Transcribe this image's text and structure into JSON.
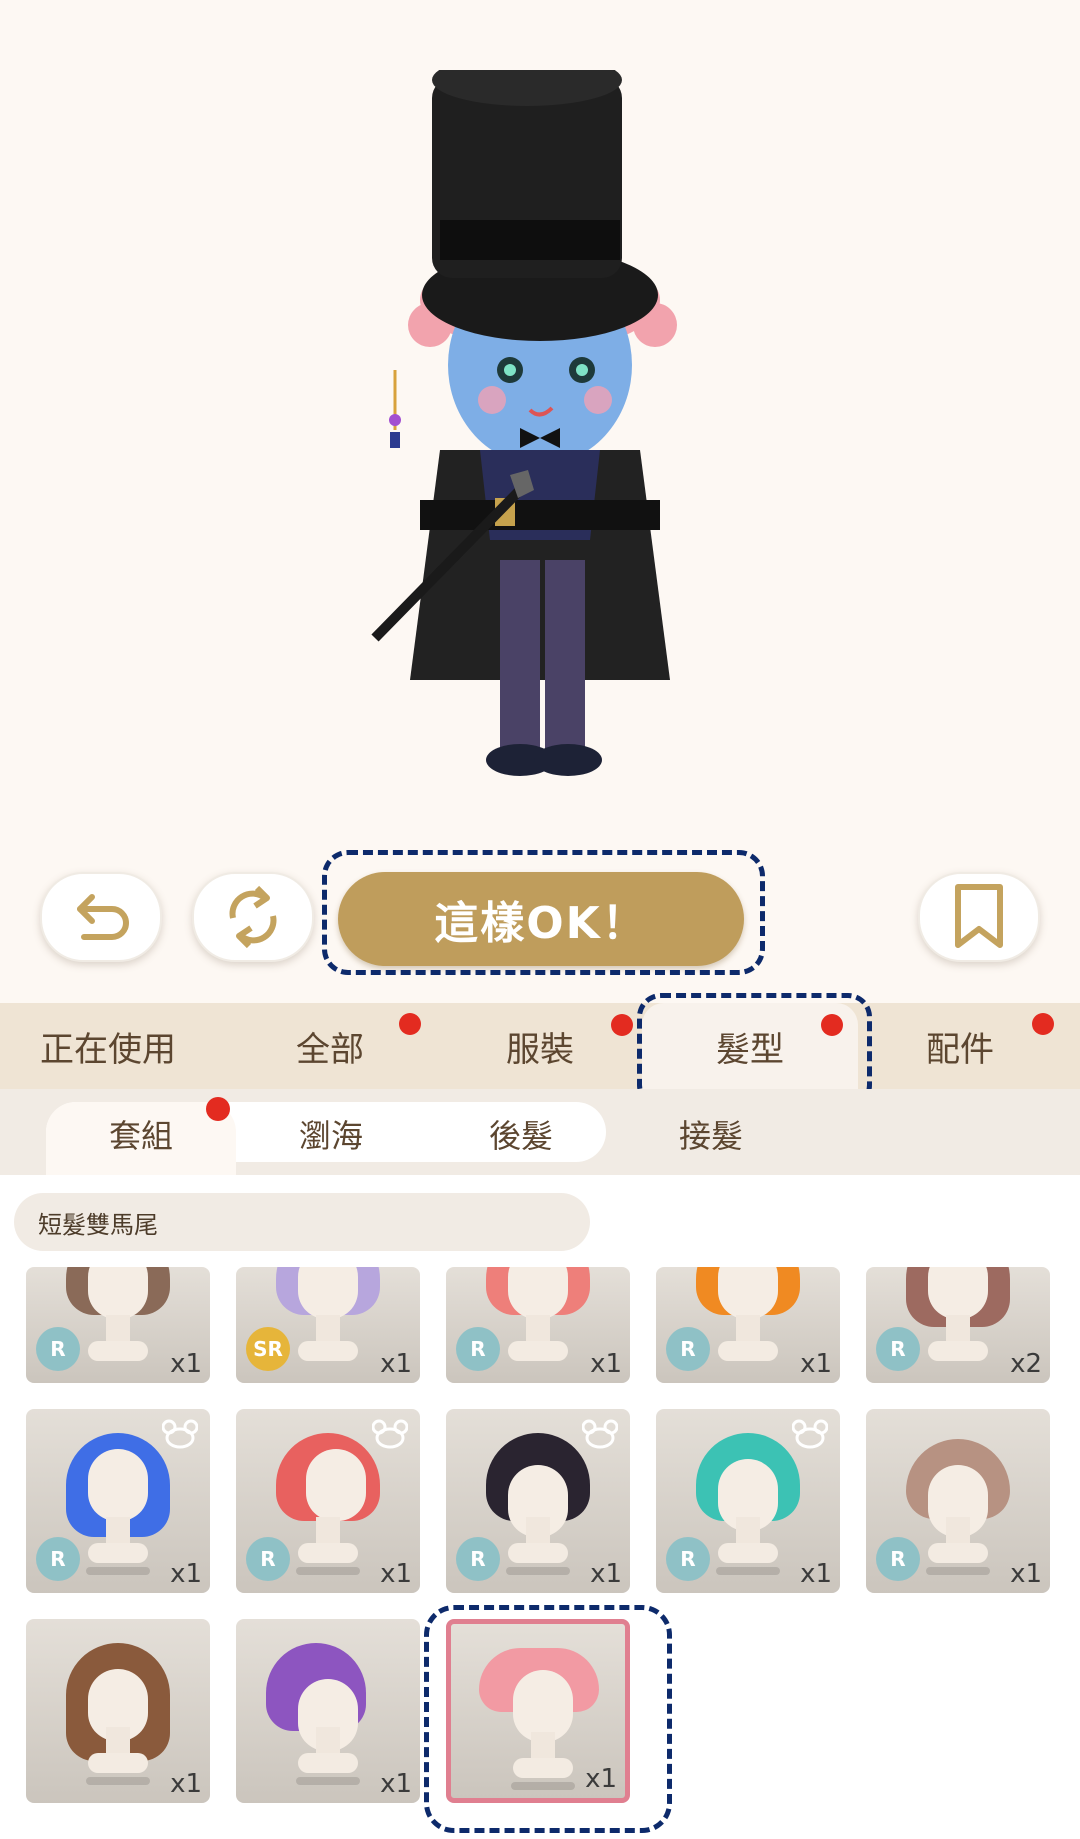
{
  "actions": {
    "ok_label": "這樣OK！"
  },
  "category_tabs": [
    {
      "label": "正在使用",
      "has_dot": false
    },
    {
      "label": "全部",
      "has_dot": true
    },
    {
      "label": "服裝",
      "has_dot": true
    },
    {
      "label": "髮型",
      "has_dot": true,
      "active": true
    },
    {
      "label": "配件",
      "has_dot": true
    }
  ],
  "sub_tabs": [
    {
      "label": "套組",
      "has_dot": true,
      "active": true
    },
    {
      "label": "瀏海",
      "has_dot": false
    },
    {
      "label": "後髮",
      "has_dot": false
    },
    {
      "label": "接髮",
      "has_dot": false
    }
  ],
  "filter_label": "短髮雙馬尾",
  "items_row1": [
    {
      "rarity": "R",
      "count": "x1",
      "hair": "#8a6a58"
    },
    {
      "rarity": "SR",
      "count": "x1",
      "hair": "#b7a6dd"
    },
    {
      "rarity": "R",
      "count": "x1",
      "hair": "#ee7f7a"
    },
    {
      "rarity": "R",
      "count": "x1",
      "hair": "#f08a22"
    },
    {
      "rarity": "R",
      "count": "x2",
      "hair": "#9d6a60"
    }
  ],
  "items_row2": [
    {
      "rarity": "R",
      "count": "x1",
      "hair": "#3f6ee6"
    },
    {
      "rarity": "R",
      "count": "x1",
      "hair": "#e8615f"
    },
    {
      "rarity": "R",
      "count": "x1",
      "hair": "#2a2430"
    },
    {
      "rarity": "R",
      "count": "x1",
      "hair": "#3cc2b4"
    },
    {
      "rarity": "R",
      "count": "x1",
      "hair": "#b79282"
    }
  ],
  "items_row3": [
    {
      "rarity": "",
      "count": "x1",
      "hair": "#8a5a3c"
    },
    {
      "rarity": "",
      "count": "x1",
      "hair": "#8d55c0"
    },
    {
      "rarity": "",
      "count": "x1",
      "hair": "#f29aa3"
    }
  ],
  "colors": {
    "accent": "#bf9d5c",
    "highlight": "#0d2a6b",
    "badge_r": "#8fc1c6",
    "badge_sr": "#e6b53a",
    "notification": "#e32b20"
  }
}
